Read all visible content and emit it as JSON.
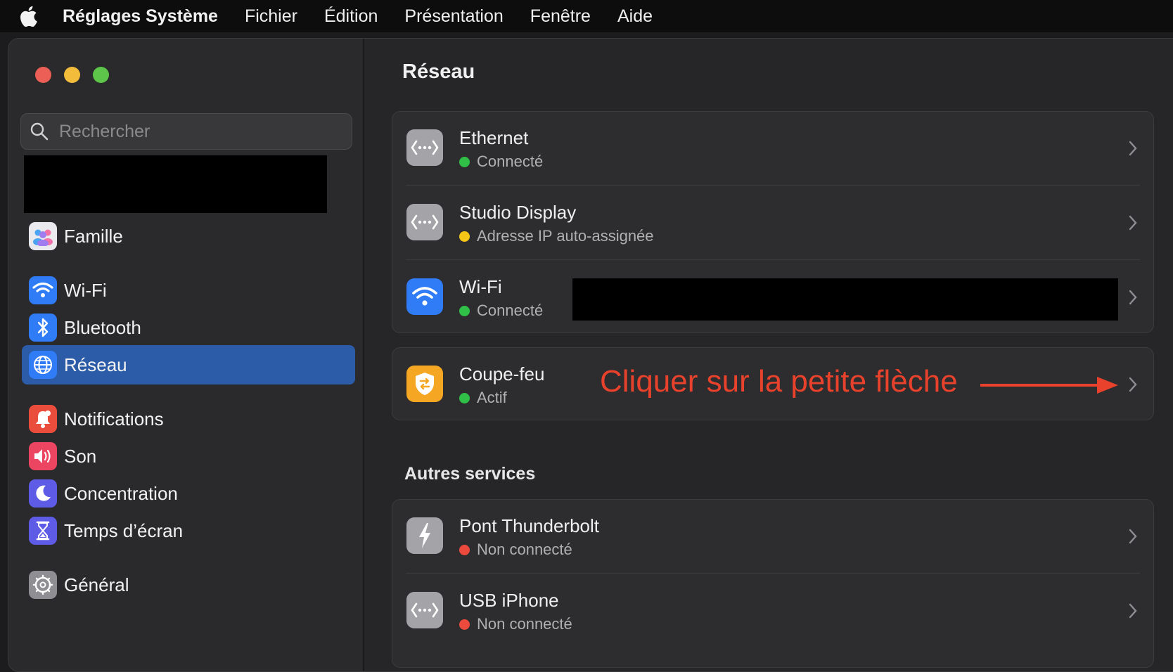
{
  "menubar": {
    "app_name": "Réglages Système",
    "items": [
      "Fichier",
      "Édition",
      "Présentation",
      "Fenêtre",
      "Aide"
    ],
    "icon": "apple-logo-icon"
  },
  "sidebar": {
    "search_placeholder": "Rechercher",
    "items": [
      {
        "label": "Famille",
        "icon": "family-icon",
        "color": "#e9e9ee"
      },
      {
        "label": "Wi-Fi",
        "icon": "wifi-icon",
        "color": "#2f7cf6"
      },
      {
        "label": "Bluetooth",
        "icon": "bluetooth-icon",
        "color": "#2f7cf6"
      },
      {
        "label": "Réseau",
        "icon": "globe-icon",
        "color": "#2f7cf6"
      },
      {
        "label": "Notifications",
        "icon": "bell-icon",
        "color": "#eb4d3d"
      },
      {
        "label": "Son",
        "icon": "speaker-icon",
        "color": "#eb4562"
      },
      {
        "label": "Concentration",
        "icon": "moon-icon",
        "color": "#5e5ce6"
      },
      {
        "label": "Temps d’écran",
        "icon": "hourglass-icon",
        "color": "#5e5ce6"
      },
      {
        "label": "Général",
        "icon": "gear-icon",
        "color": "#8e8e93"
      }
    ],
    "selected": "Réseau"
  },
  "main": {
    "title": "Réseau",
    "services": [
      {
        "name": "Ethernet",
        "status": "Connecté",
        "status_color": "#30c048",
        "icon": "ethernet-icon"
      },
      {
        "name": "Studio Display",
        "status": "Adresse IP auto-assignée",
        "status_color": "#f5c518",
        "icon": "ethernet-icon"
      },
      {
        "name": "Wi-Fi",
        "status": "Connecté",
        "status_color": "#30c048",
        "icon": "wifi-icon"
      }
    ],
    "firewall": {
      "name": "Coupe-feu",
      "status": "Actif",
      "status_color": "#30c048",
      "icon": "firewall-shield-icon"
    },
    "annotation": "Cliquer sur la petite flèche",
    "annotation_color": "#e8412c",
    "other_title": "Autres services",
    "other": [
      {
        "name": "Pont Thunderbolt",
        "status": "Non connecté",
        "status_color": "#eb4a3d",
        "icon": "thunderbolt-icon"
      },
      {
        "name": "USB iPhone",
        "status": "Non connecté",
        "status_color": "#eb4a3d",
        "icon": "ethernet-icon"
      }
    ]
  }
}
